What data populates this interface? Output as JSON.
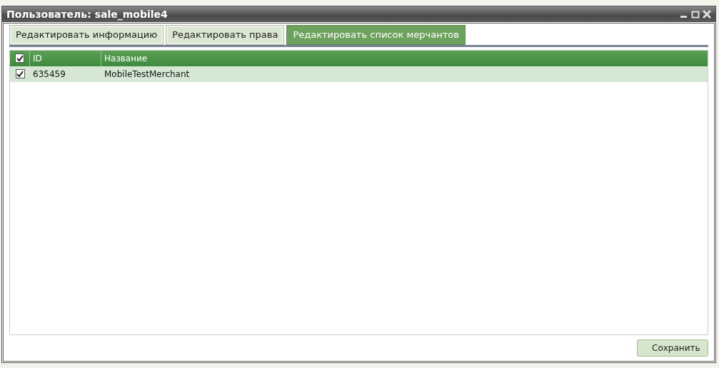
{
  "window": {
    "title": "Пользователь: sale_mobile4"
  },
  "tabs": [
    {
      "label": "Редактировать информацию",
      "selected": false
    },
    {
      "label": "Редактировать права",
      "selected": false
    },
    {
      "label": "Редактировать список мерчантов",
      "selected": true
    }
  ],
  "table": {
    "header_checked": true,
    "columns": [
      "ID",
      "Название"
    ],
    "rows": [
      {
        "checked": true,
        "cells": [
          "635459",
          "MobileTestMerchant"
        ]
      }
    ]
  },
  "buttons": [
    "Сохранить"
  ]
}
